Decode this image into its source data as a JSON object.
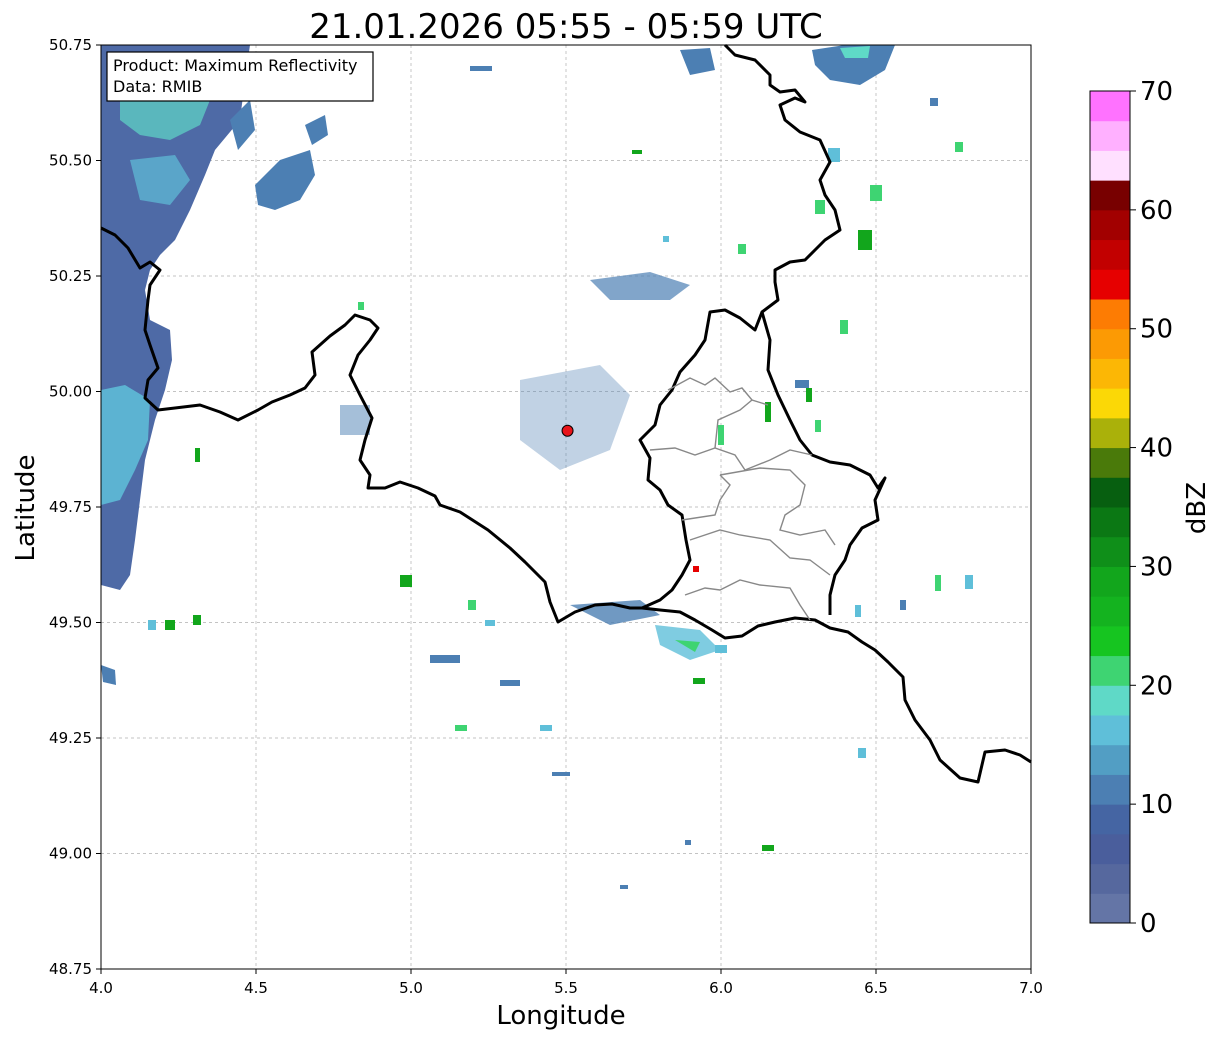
{
  "title": "21.01.2026 05:55 - 05:59 UTC",
  "info_box": {
    "line1": "Product: Maximum Reflectivity",
    "line2": "Data: RMIB"
  },
  "axes": {
    "xlabel": "Longitude",
    "ylabel": "Latitude",
    "xlim": [
      4.0,
      7.0
    ],
    "ylim": [
      48.75,
      50.75
    ],
    "xticks": [
      "4.0",
      "4.5",
      "5.0",
      "5.5",
      "6.0",
      "6.5",
      "7.0"
    ],
    "yticks": [
      "48.75",
      "49.00",
      "49.25",
      "49.50",
      "49.75",
      "50.00",
      "50.25",
      "50.50",
      "50.75"
    ],
    "grid": true
  },
  "radar_site": {
    "lon": 5.505,
    "lat": 49.915,
    "color": "#e8141a"
  },
  "colorbar": {
    "label": "dBZ",
    "ticks": [
      "0",
      "10",
      "20",
      "30",
      "40",
      "50",
      "60",
      "70"
    ],
    "range": [
      0,
      70
    ],
    "step": 2.5,
    "colors": [
      "#6475a6",
      "#56689e",
      "#4a5e9c",
      "#4565a3",
      "#4c7fb3",
      "#529ec4",
      "#5fbfd9",
      "#5fd9c7",
      "#3ed472",
      "#16c520",
      "#14b31f",
      "#12a61c",
      "#0f8f19",
      "#0b7814",
      "#075f10",
      "#4a7a0a",
      "#aab10a",
      "#fbd806",
      "#fcb705",
      "#fc9a04",
      "#fd7c03",
      "#e60000",
      "#c20000",
      "#a20000",
      "#780000",
      "#ffe0ff",
      "#ffb0ff",
      "#ff72ff",
      "#ee3aee"
    ]
  },
  "colors": {
    "country_border": "#000000",
    "province_border": "#888888",
    "grid": "#b0b0b0"
  }
}
